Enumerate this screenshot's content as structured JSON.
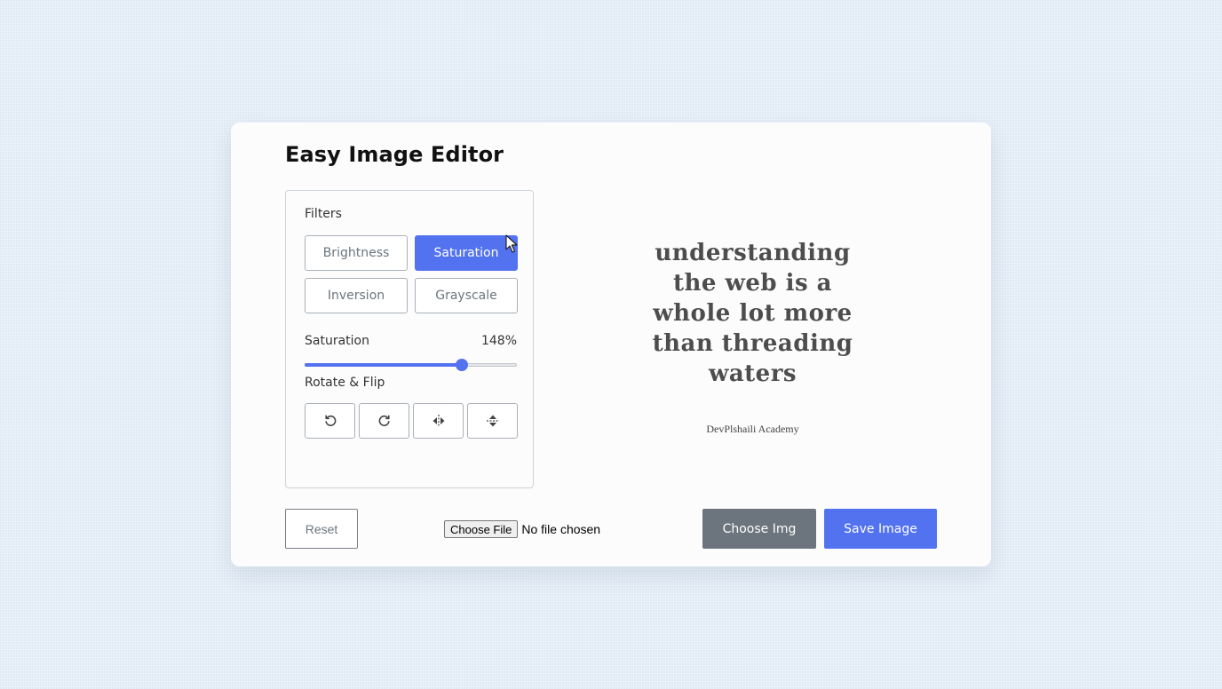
{
  "app": {
    "title": "Easy Image Editor"
  },
  "filters": {
    "label": "Filters",
    "options": [
      {
        "label": "Brightness",
        "active": false
      },
      {
        "label": "Saturation",
        "active": true
      },
      {
        "label": "Inversion",
        "active": false
      },
      {
        "label": "Grayscale",
        "active": false
      }
    ]
  },
  "slider": {
    "name": "Saturation",
    "value_text": "148%",
    "value": 148,
    "max": 200
  },
  "rotate": {
    "label": "Rotate & Flip",
    "buttons": [
      {
        "icon": "rotate-left-icon"
      },
      {
        "icon": "rotate-right-icon"
      },
      {
        "icon": "flip-horizontal-icon"
      },
      {
        "icon": "flip-vertical-icon"
      }
    ]
  },
  "preview": {
    "quote_lines": [
      "understanding",
      "the web is a",
      "whole lot more",
      "than threading",
      "waters"
    ],
    "signature": "DevPlshaili Academy"
  },
  "controls": {
    "reset_label": "Reset",
    "file_button_label": "Choose File",
    "file_status": "No file chosen",
    "choose_img_label": "Choose Img",
    "save_label": "Save Image"
  },
  "colors": {
    "accent": "#5372f0",
    "secondary": "#6c757d",
    "background": "#e9f1f9",
    "card": "#fcfcfc"
  }
}
